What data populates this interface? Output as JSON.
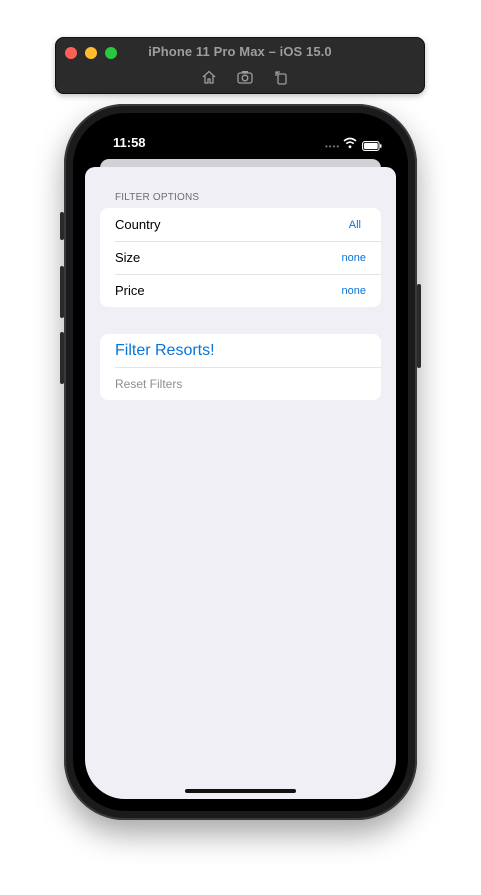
{
  "simulator": {
    "title": "iPhone 11 Pro Max – iOS 15.0",
    "tools": [
      "home-icon",
      "screenshot-icon",
      "rotate-icon"
    ]
  },
  "status_bar": {
    "time": "11:58",
    "icons": [
      "signal-dots-icon",
      "wifi-icon",
      "battery-icon"
    ]
  },
  "filter_section": {
    "header": "FILTER OPTIONS",
    "rows": [
      {
        "label": "Country",
        "value": "All"
      },
      {
        "label": "Size",
        "value": "none"
      },
      {
        "label": "Price",
        "value": "none"
      }
    ]
  },
  "actions": {
    "primary": "Filter Resorts!",
    "secondary": "Reset Filters"
  },
  "colors": {
    "accent": "#0a74d9",
    "background": "#f0eff5",
    "secondary_text": "#8e8e93"
  }
}
